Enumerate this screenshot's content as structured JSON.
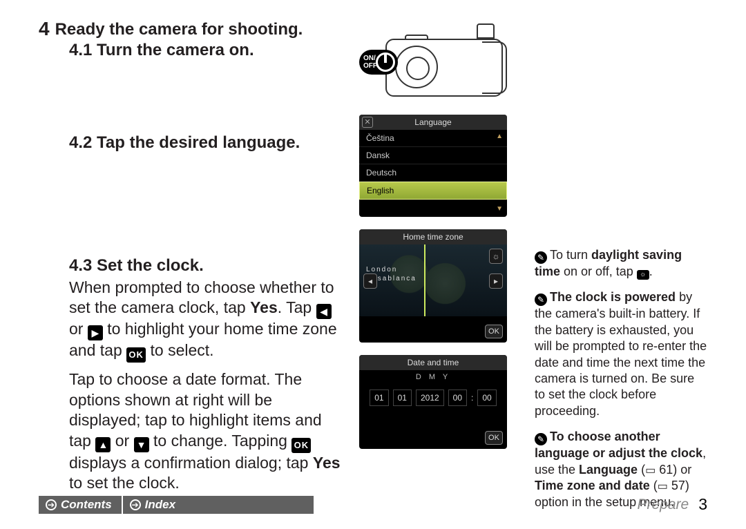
{
  "step": {
    "number": "4",
    "title": "Ready the camera for shooting.",
    "sub1": "4.1  Turn the camera on.",
    "sub2": "4.2  Tap the desired language.",
    "sub3": "4.3  Set the clock."
  },
  "body": {
    "p1a": "When prompted to choose whether to set the camera clock, tap ",
    "yes": "Yes",
    "p1b": ". Tap ",
    "p1c": " or ",
    "p1d": " to highlight your home time zone and tap ",
    "p1e": " to select.",
    "p2a": "Tap to choose a date format. The options shown at right will be displayed; tap to highlight items and tap ",
    "p2b": " or ",
    "p2c": " to change. Tapping ",
    "p2d": " displays a confirmation dialog; tap ",
    "p2e": " to set the clock."
  },
  "icons": {
    "left": "◀",
    "right": "▶",
    "up": "▲",
    "down": "▼",
    "ok": "OK",
    "onoff_line1": "ON/",
    "onoff_line2": "OFF"
  },
  "lcd_lang": {
    "title": "Language",
    "items": [
      "Čeština",
      "Dansk",
      "Deutsch",
      "English"
    ]
  },
  "lcd_tz": {
    "title": "Home time zone",
    "city1": "London",
    "city2": "Casablanca",
    "ok": "OK"
  },
  "lcd_dt": {
    "title": "Date and time",
    "format": "D  M  Y",
    "cells": [
      "01",
      "01",
      "2012",
      "00",
      "00"
    ],
    "sep": ":",
    "ok": "OK"
  },
  "tips": {
    "t1a": "To turn ",
    "t1b": "daylight saving time",
    "t1c": " on or off, tap ",
    "t1d": ".",
    "t2a": "The clock is powered",
    "t2b": " by the camera's built-in battery. If the battery is exhausted, you will be prompted to re-enter the date and time the next time the camera is turned on. Be sure to set the clock before proceeding.",
    "t3a": "To choose another language or adjust the clock",
    "t3b": ", use the ",
    "t3c": "Language",
    "t3d": " (",
    "t3e": " 61) or ",
    "t3f": "Time zone and date",
    "t3g": " (",
    "t3h": " 57) option in the setup menu."
  },
  "footer": {
    "contents": "Contents",
    "index": "Index",
    "section": "Prepare",
    "page": "3"
  }
}
